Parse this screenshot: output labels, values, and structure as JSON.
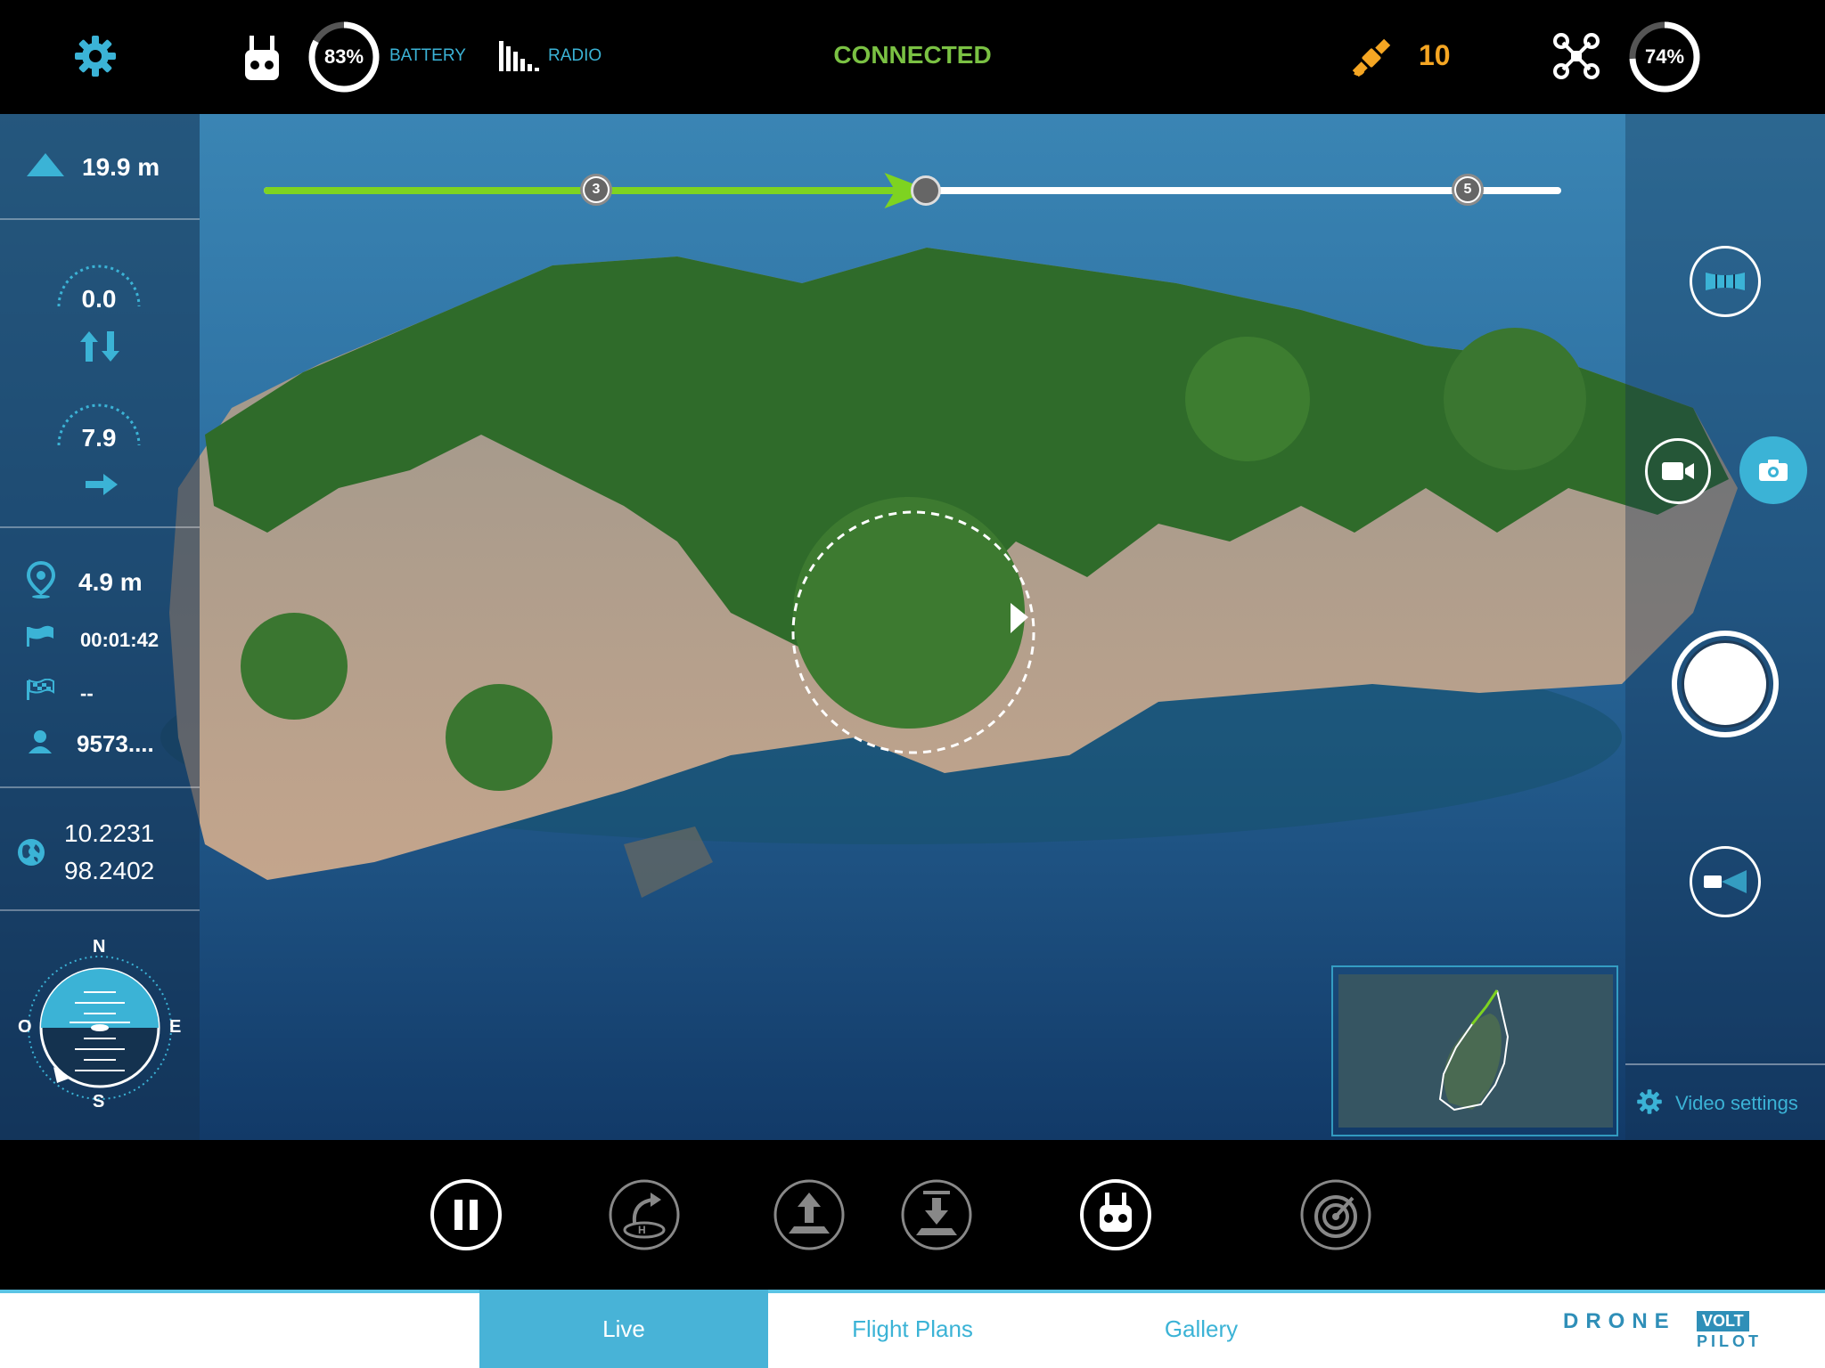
{
  "status_bar": {
    "remote_battery_percent": "83%",
    "remote_battery_value": 0.83,
    "battery_label": "BATTERY",
    "radio_label": "RADIO",
    "connection_status": "CONNECTED",
    "satellite_count": "10",
    "drone_battery_percent": "74%",
    "drone_battery_value": 0.74,
    "icons": [
      "gear-icon",
      "remote-controller-icon",
      "signal-bars-icon",
      "satellite-icon",
      "drone-icon"
    ]
  },
  "telemetry": {
    "altitude": "19.9 m",
    "vertical_speed": "0.0",
    "horizontal_speed": "7.9",
    "distance": "4.9 m",
    "flight_time": "00:01:42",
    "finish_value": "--",
    "pilot_value": "9573....",
    "latitude": "10.2231",
    "longitude": "98.2402",
    "compass": {
      "n": "N",
      "e": "E",
      "s": "S",
      "w": "O"
    }
  },
  "waypoints": {
    "markers": [
      "3",
      "5"
    ],
    "progress": 0.51
  },
  "camera": {
    "video_settings_label": "Video settings",
    "modes": [
      "panorama",
      "video",
      "photo"
    ],
    "active_mode": "photo"
  },
  "controls": [
    "pause",
    "return-home",
    "takeoff",
    "land",
    "remote-control",
    "target"
  ],
  "tabs": [
    {
      "label": "Live",
      "active": true
    },
    {
      "label": "Flight Plans",
      "active": false
    },
    {
      "label": "Gallery",
      "active": false
    }
  ],
  "brand": {
    "line1": "DRONE",
    "line1b": "VOLT",
    "line2": "PILOT"
  },
  "colors": {
    "accent": "#3bb3d6",
    "connected": "#7ac143",
    "satellite": "#f5a623",
    "progress": "#7ed321"
  }
}
